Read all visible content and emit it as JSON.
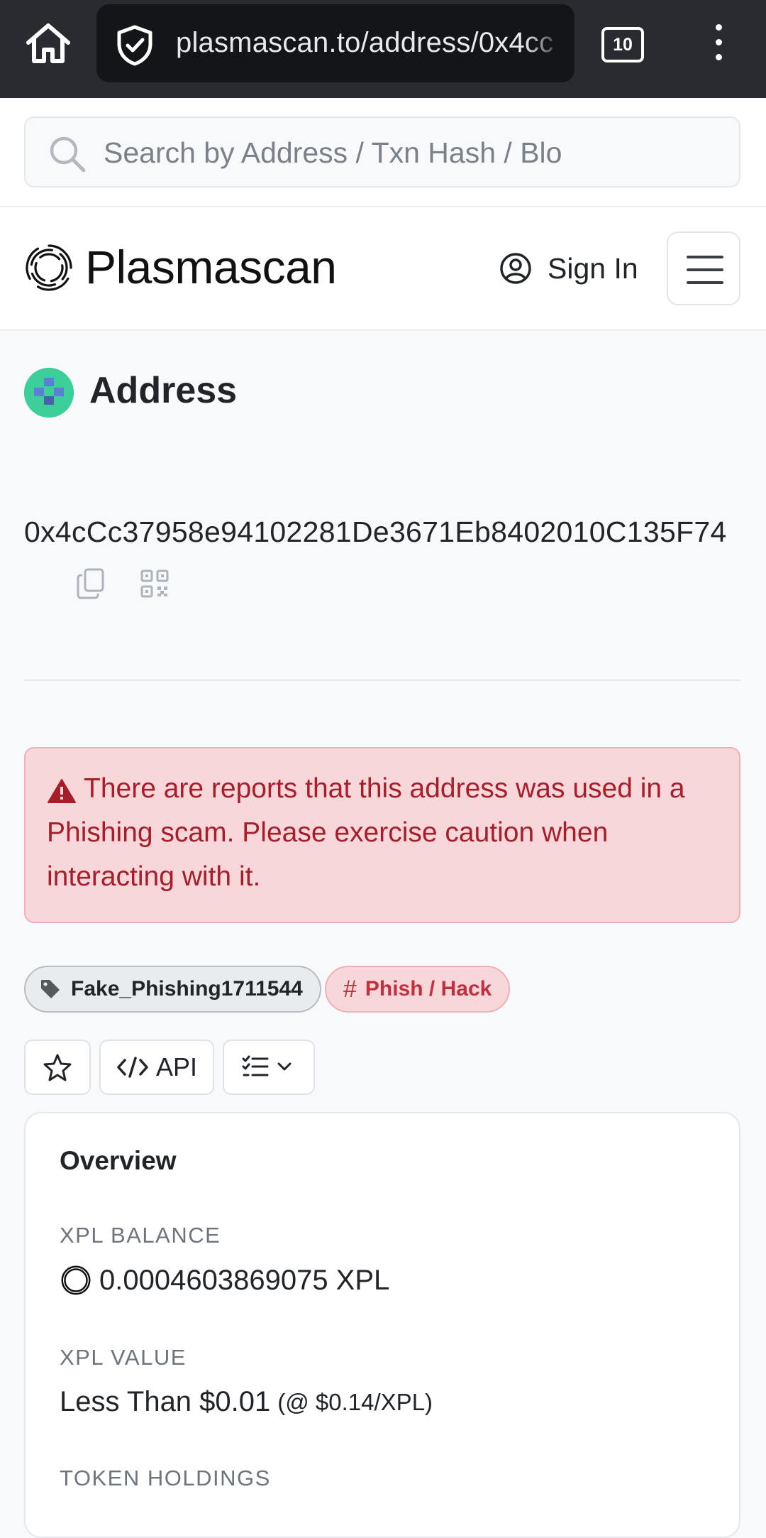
{
  "browser": {
    "url": "plasmascan.to/address/0x4cc",
    "tab_count": "10"
  },
  "search": {
    "placeholder": "Search by Address / Txn Hash / Blo"
  },
  "header": {
    "brand": "Plasmascan",
    "sign_in": "Sign In"
  },
  "page": {
    "title": "Address",
    "address": "0x4cCc37958e94102281De3671Eb8402010C135F74"
  },
  "alert": {
    "text": "There are reports that this address was used in a Phishing scam. Please exercise caution when interacting with it."
  },
  "tags": {
    "name_tag": "Fake_Phishing1711544",
    "category_tag": "Phish / Hack"
  },
  "actions": {
    "api_label": "API"
  },
  "overview": {
    "title": "Overview",
    "balance_label": "XPL BALANCE",
    "balance_value": "0.0004603869075 XPL",
    "value_label": "XPL VALUE",
    "value_main": "Less Than $0.01",
    "value_rate": "(@ $0.14/XPL)",
    "holdings_label": "TOKEN HOLDINGS"
  },
  "colors": {
    "chrome": "#2a2b31",
    "alert_bg": "#f8d7da",
    "alert_text": "#a71d2a",
    "avatar": "#3ccf9a"
  }
}
